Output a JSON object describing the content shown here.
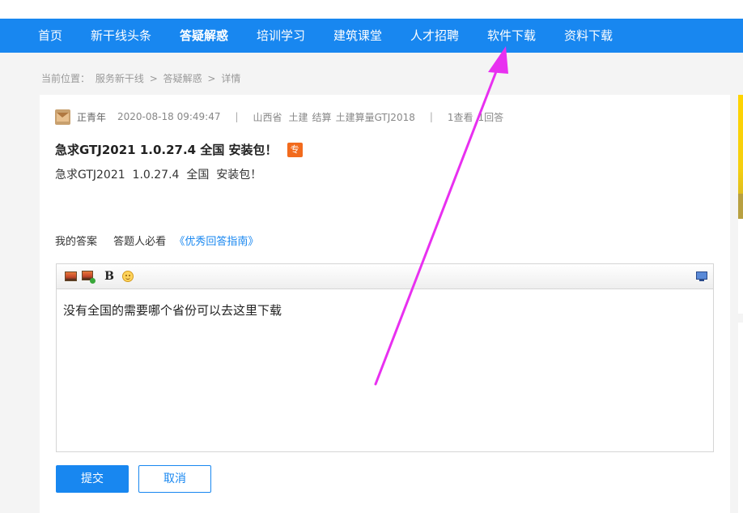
{
  "nav": {
    "items": [
      "首页",
      "新干线头条",
      "答疑解惑",
      "培训学习",
      "建筑课堂",
      "人才招聘",
      "软件下载",
      "资料下载"
    ],
    "active_index": 2
  },
  "breadcrumb": {
    "label": "当前位置：",
    "path": [
      "服务新干线",
      ">",
      "答疑解惑",
      ">",
      "详情"
    ]
  },
  "question": {
    "author": "正青年",
    "time": "2020-08-18 09:49:47",
    "separator": "|",
    "province": "山西省",
    "tags": [
      "土建",
      "结算",
      "土建算量GTJ2018"
    ],
    "stats": [
      "1查看",
      "1回答"
    ],
    "title": "急求GTJ2021 1.0.27.4 全国 安装包！",
    "badge": "专",
    "body": "急求GTJ2021  1.0.27.4  全国  安装包！"
  },
  "answer": {
    "my_answer_label": "我的答案",
    "must_read_label": "答题人必看",
    "guide_link": "《优秀回答指南》"
  },
  "editor": {
    "toolbar": [
      "image-icon",
      "image-upload-icon",
      "bold-icon",
      "emoji-icon",
      "fullscreen-icon"
    ],
    "bold_glyph": "B",
    "content": "没有全国的需要哪个省份可以去这里下载"
  },
  "buttons": {
    "submit": "提交",
    "cancel": "取消"
  },
  "colors": {
    "nav_bg": "#1887f0",
    "accent": "#1887f0",
    "badge": "#f26b1d",
    "annotation_arrow": "#e830f0"
  }
}
